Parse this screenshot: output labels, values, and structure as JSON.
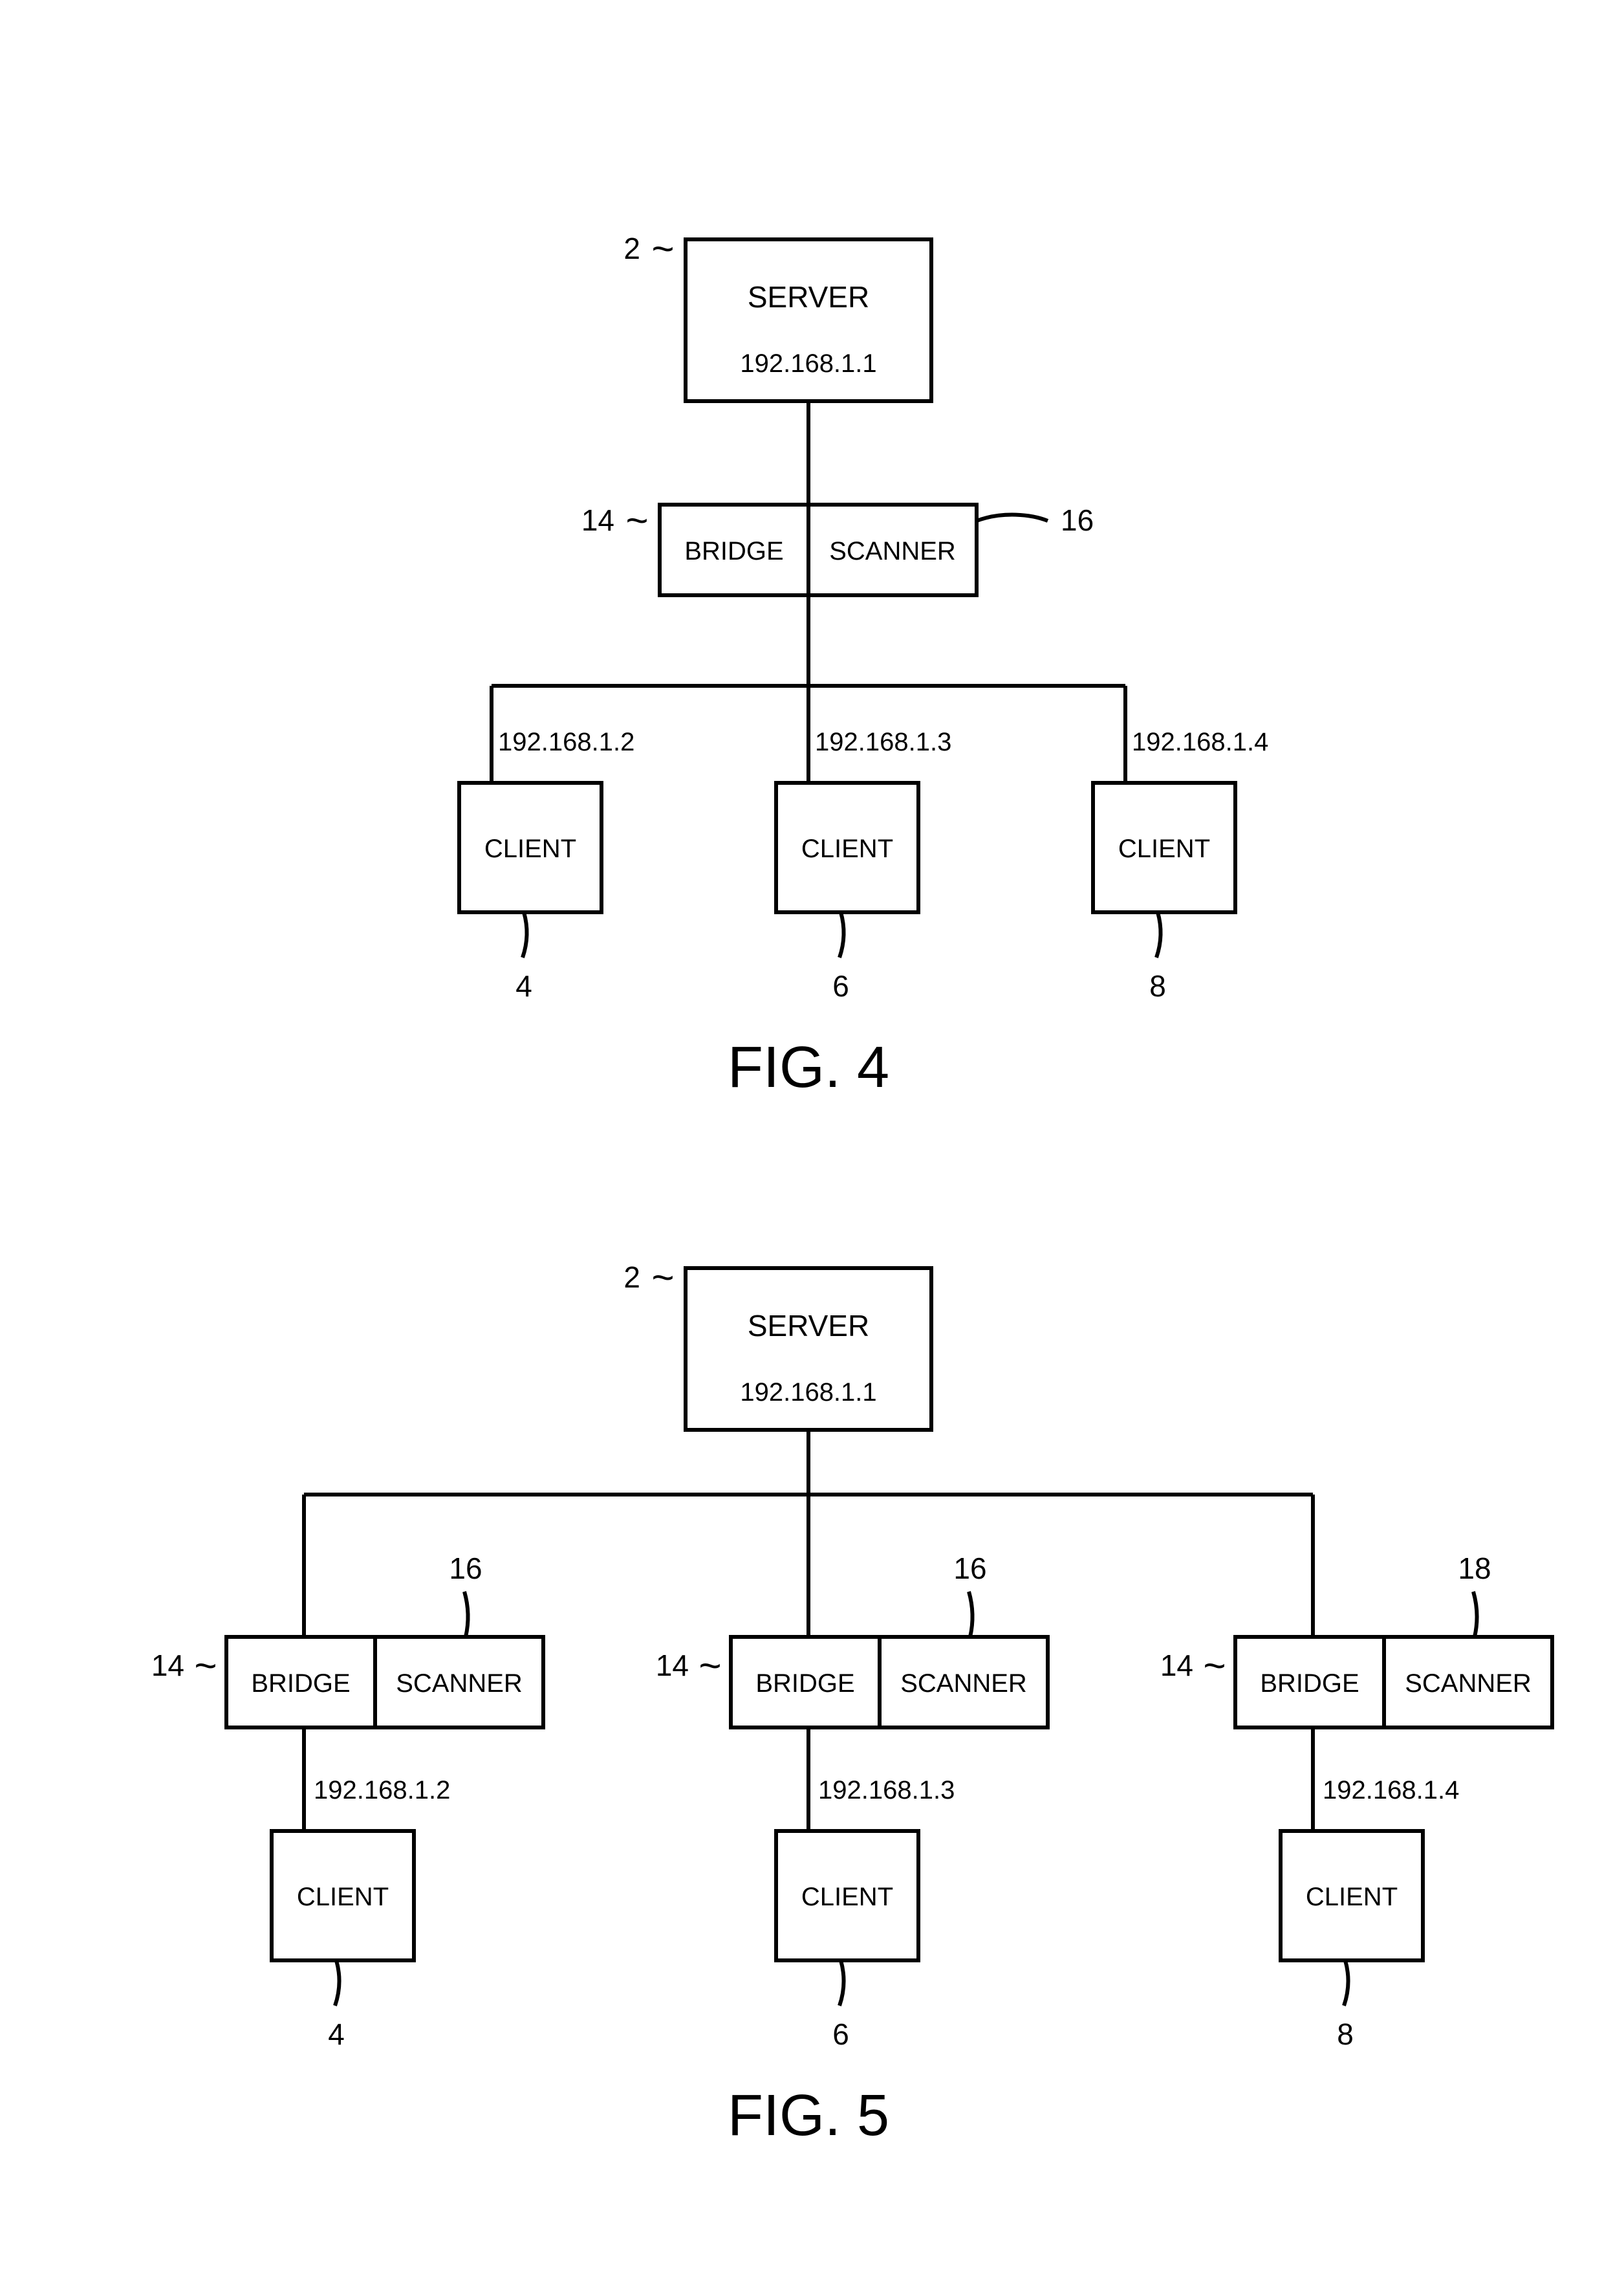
{
  "fig4": {
    "caption": "FIG. 4",
    "server": {
      "label": "SERVER",
      "ip": "192.168.1.1",
      "ref": "2"
    },
    "bridge": {
      "label": "BRIDGE",
      "ref": "14"
    },
    "scanner": {
      "label": "SCANNER",
      "ref": "16"
    },
    "clients": [
      {
        "label": "CLIENT",
        "ip": "192.168.1.2",
        "ref": "4"
      },
      {
        "label": "CLIENT",
        "ip": "192.168.1.3",
        "ref": "6"
      },
      {
        "label": "CLIENT",
        "ip": "192.168.1.4",
        "ref": "8"
      }
    ]
  },
  "fig5": {
    "caption": "FIG. 5",
    "server": {
      "label": "SERVER",
      "ip": "192.168.1.1",
      "ref": "2"
    },
    "branches": [
      {
        "bridge": {
          "label": "BRIDGE",
          "ref": "14"
        },
        "scanner": {
          "label": "SCANNER",
          "ref": "16"
        },
        "client": {
          "label": "CLIENT",
          "ip": "192.168.1.2",
          "ref": "4"
        }
      },
      {
        "bridge": {
          "label": "BRIDGE",
          "ref": "14"
        },
        "scanner": {
          "label": "SCANNER",
          "ref": "16"
        },
        "client": {
          "label": "CLIENT",
          "ip": "192.168.1.3",
          "ref": "6"
        }
      },
      {
        "bridge": {
          "label": "BRIDGE",
          "ref": "14"
        },
        "scanner": {
          "label": "SCANNER",
          "ref": "18"
        },
        "client": {
          "label": "CLIENT",
          "ip": "192.168.1.4",
          "ref": "8"
        }
      }
    ]
  }
}
